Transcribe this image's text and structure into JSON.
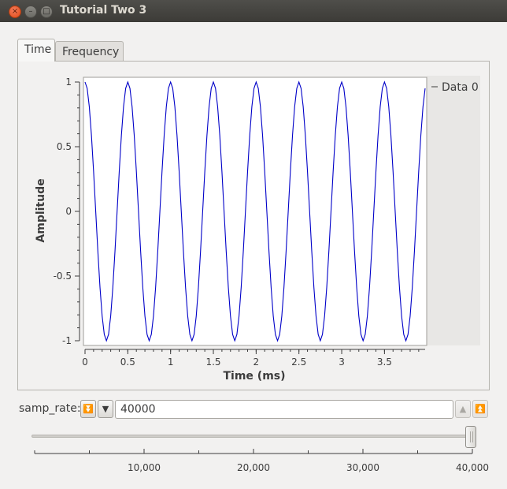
{
  "window": {
    "title": "Tutorial Two 3"
  },
  "tabs": [
    {
      "label": "Time",
      "active": true
    },
    {
      "label": "Frequency",
      "active": false
    }
  ],
  "chart_data": {
    "type": "line",
    "title": "",
    "xlabel": "Time (ms)",
    "ylabel": "Amplitude",
    "xlim": [
      0,
      3.975
    ],
    "ylim": [
      -1,
      1
    ],
    "xticks": [
      0,
      0.5,
      1,
      1.5,
      2,
      2.5,
      3,
      3.5
    ],
    "yticks": [
      1,
      0.5,
      0,
      -0.5,
      -1
    ],
    "grid": false,
    "legend": "right",
    "series": [
      {
        "name": "Data 0",
        "color": "#0000c8",
        "waveform": "cosine",
        "frequency_khz": 2,
        "amplitude": 1,
        "sample_rate_hz": 40000
      }
    ]
  },
  "controls": {
    "samp_rate": {
      "label": "samp_rate:",
      "value": "40000",
      "slider": {
        "min": 0,
        "max": 40000,
        "value": 40000,
        "tick_labels": [
          "10,000",
          "20,000",
          "30,000",
          "40,000"
        ]
      }
    }
  },
  "icons": {
    "close": "close-icon",
    "minimize": "minimize-icon",
    "maximize": "maximize-icon",
    "decrement_large": "double-down-arrow-icon",
    "decrement": "down-arrow-icon",
    "increment": "up-arrow-icon",
    "increment_large": "double-up-arrow-icon"
  },
  "colors": {
    "titlebar": "#3c3b37",
    "close_button": "#df4a16",
    "trace": "#0000c8"
  }
}
